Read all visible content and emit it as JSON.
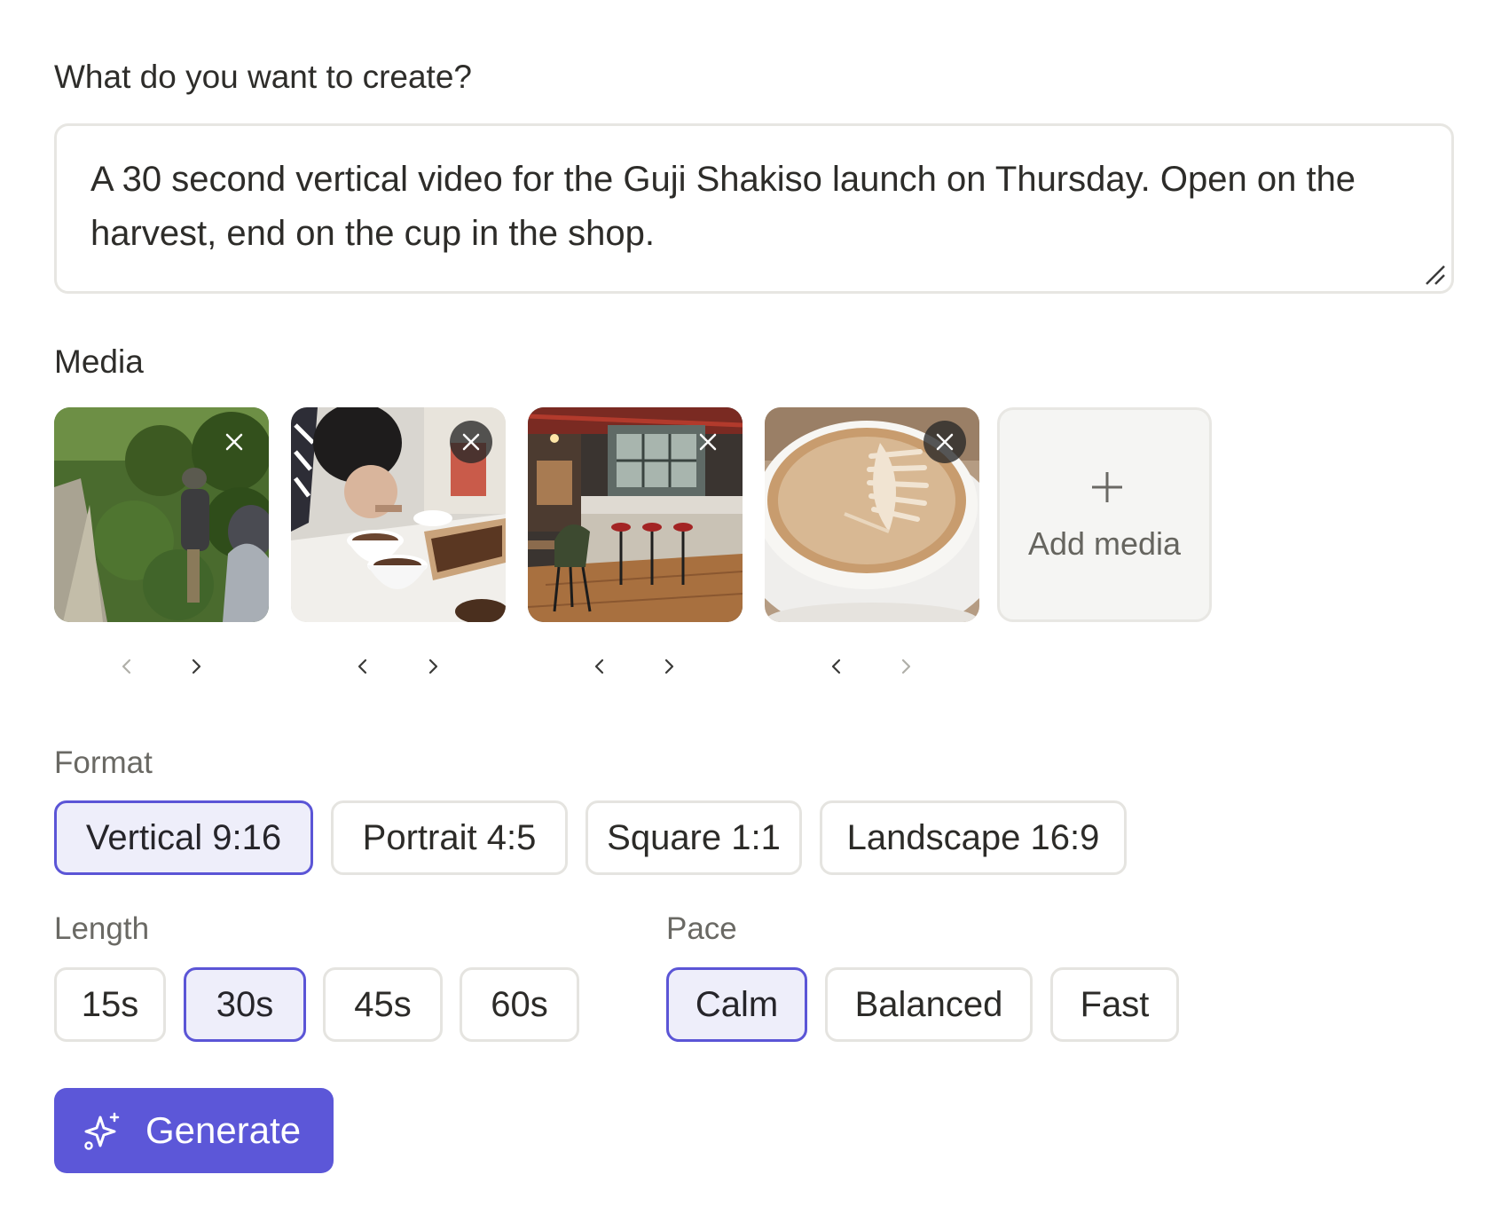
{
  "prompt": {
    "label": "What do you want to create?",
    "value": "A 30 second vertical video for the Guji Shakiso launch on Thursday. Open on the harvest, end on the cup in the shop."
  },
  "media": {
    "label": "Media",
    "items": [
      {
        "name": "coffee-harvest-photo",
        "icon": "close-icon"
      },
      {
        "name": "coffee-cupping-photo",
        "icon": "close-icon"
      },
      {
        "name": "coffee-shop-interior-photo",
        "icon": "close-icon"
      },
      {
        "name": "latte-art-cup-photo",
        "icon": "close-icon"
      }
    ],
    "add_label": "Add media",
    "add_icon": "plus-icon"
  },
  "format": {
    "label": "Format",
    "options": [
      "Vertical 9:16",
      "Portrait 4:5",
      "Square 1:1",
      "Landscape 16:9"
    ],
    "selected": "Vertical 9:16"
  },
  "length": {
    "label": "Length",
    "options": [
      "15s",
      "30s",
      "45s",
      "60s"
    ],
    "selected": "30s"
  },
  "pace": {
    "label": "Pace",
    "options": [
      "Calm",
      "Balanced",
      "Fast"
    ],
    "selected": "Calm"
  },
  "generate": {
    "label": "Generate",
    "icon": "sparkle-icon"
  },
  "colors": {
    "accent": "#5c57d8",
    "selected_bg": "#eeeefa",
    "border": "#e5e4e0"
  }
}
